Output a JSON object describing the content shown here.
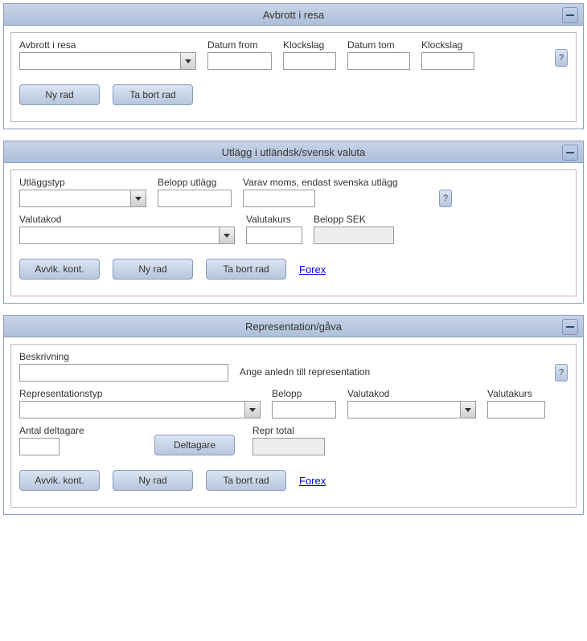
{
  "section1": {
    "title": "Avbrott i resa",
    "fields": {
      "f1": "Avbrott i resa",
      "f2": "Datum from",
      "f3": "Klockslag",
      "f4": "Datum tom",
      "f5": "Klockslag"
    },
    "help": "?",
    "buttons": {
      "new": "Ny rad",
      "del": "Ta bort rad"
    }
  },
  "section2": {
    "title": "Utlägg i utländsk/svensk valuta",
    "fields": {
      "f1": "Utläggstyp",
      "f2": "Belopp utlägg",
      "f3": "Varav moms, endast svenska utlägg",
      "f4": "Valutakod",
      "f5": "Valutakurs",
      "f6": "Belopp SEK"
    },
    "help": "?",
    "buttons": {
      "avvik": "Avvik. kont.",
      "new": "Ny rad",
      "del": "Ta bort rad"
    },
    "link": "Forex"
  },
  "section3": {
    "title": "Representation/gåva",
    "fields": {
      "f1": "Beskrivning",
      "hint": "Ange anledn till representation",
      "f2": "Representationstyp",
      "f3": "Belopp",
      "f4": "Valutakod",
      "f5": "Valutakurs",
      "f6": "Antal deltagare",
      "f7": "Repr total"
    },
    "help": "?",
    "buttons": {
      "delt": "Deltagare",
      "avvik": "Avvik. kont.",
      "new": "Ny rad",
      "del": "Ta bort rad"
    },
    "link": "Forex"
  }
}
